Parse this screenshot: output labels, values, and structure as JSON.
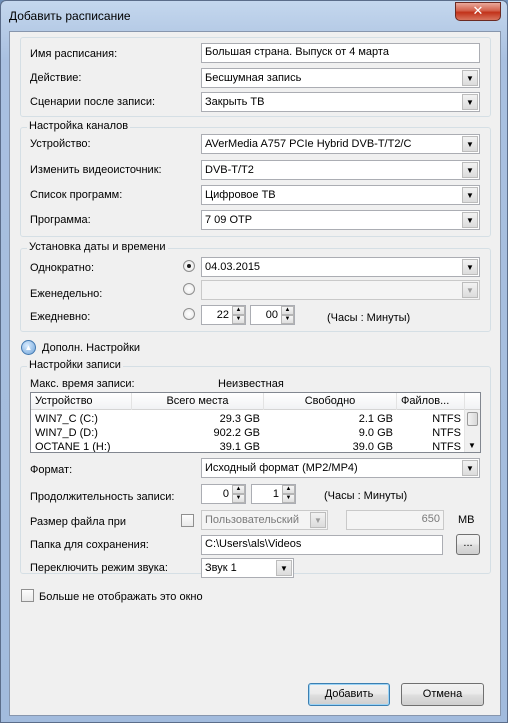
{
  "window": {
    "title": "Добавить расписание",
    "close_glyph": "✕"
  },
  "schedule": {
    "name_label": "Имя расписания:",
    "name_value": "Большая страна. Выпуск от 4 марта",
    "action_label": "Действие:",
    "action_value": "Бесшумная запись",
    "after_label": "Сценарии после записи:",
    "after_value": "Закрыть ТВ"
  },
  "channels": {
    "group_title": "Настройка каналов",
    "device_label": "Устройство:",
    "device_value": "AVerMedia A757 PCIe Hybrid DVB-T/T2/C",
    "source_label": "Изменить видеоисточник:",
    "source_value": "DVB-T/T2",
    "list_label": "Список программ:",
    "list_value": "Цифровое ТВ",
    "program_label": "Программа:",
    "program_value": "7 09 ОТР"
  },
  "datetime": {
    "group_title": "Установка даты и времени",
    "once_label": "Однократно:",
    "once_value": "04.03.2015",
    "weekly_label": "Еженедельно:",
    "daily_label": "Ежедневно:",
    "hours": "22",
    "minutes": "00",
    "hint": "(Часы : Минуты)"
  },
  "advanced": {
    "label": "Дополн. Настройки"
  },
  "record": {
    "group_title": "Настройки записи",
    "max_time_label": "Макс. время записи:",
    "max_time_value": "Неизвестная",
    "columns": [
      "Устройство",
      "Всего места",
      "Свободно",
      "Файлов..."
    ],
    "drives": [
      {
        "device": "WIN7_C (C:)",
        "total": "29.3 GB",
        "free": "2.1 GB",
        "fs": "NTFS"
      },
      {
        "device": "WIN7_D (D:)",
        "total": "902.2 GB",
        "free": "9.0 GB",
        "fs": "NTFS"
      },
      {
        "device": "OCTANE 1 (H:)",
        "total": "39.1 GB",
        "free": "39.0 GB",
        "fs": "NTFS"
      }
    ],
    "format_label": "Формат:",
    "format_value": "Исходный формат (MP2/MP4)",
    "duration_label": "Продолжительность записи:",
    "duration_hours": "0",
    "duration_minutes": "1",
    "duration_hint": "(Часы : Минуты)",
    "size_label": "Размер файла при",
    "size_mode": "Пользовательский",
    "size_value": "650",
    "size_unit": "MB",
    "folder_label": "Папка для сохранения:",
    "folder_value": "C:\\Users\\als\\Videos",
    "browse_label": "...",
    "audio_label": "Переключить режим звука:",
    "audio_value": "Звук 1"
  },
  "dont_show_label": "Больше не отображать это окно",
  "buttons": {
    "add": "Добавить",
    "cancel": "Отмена"
  }
}
